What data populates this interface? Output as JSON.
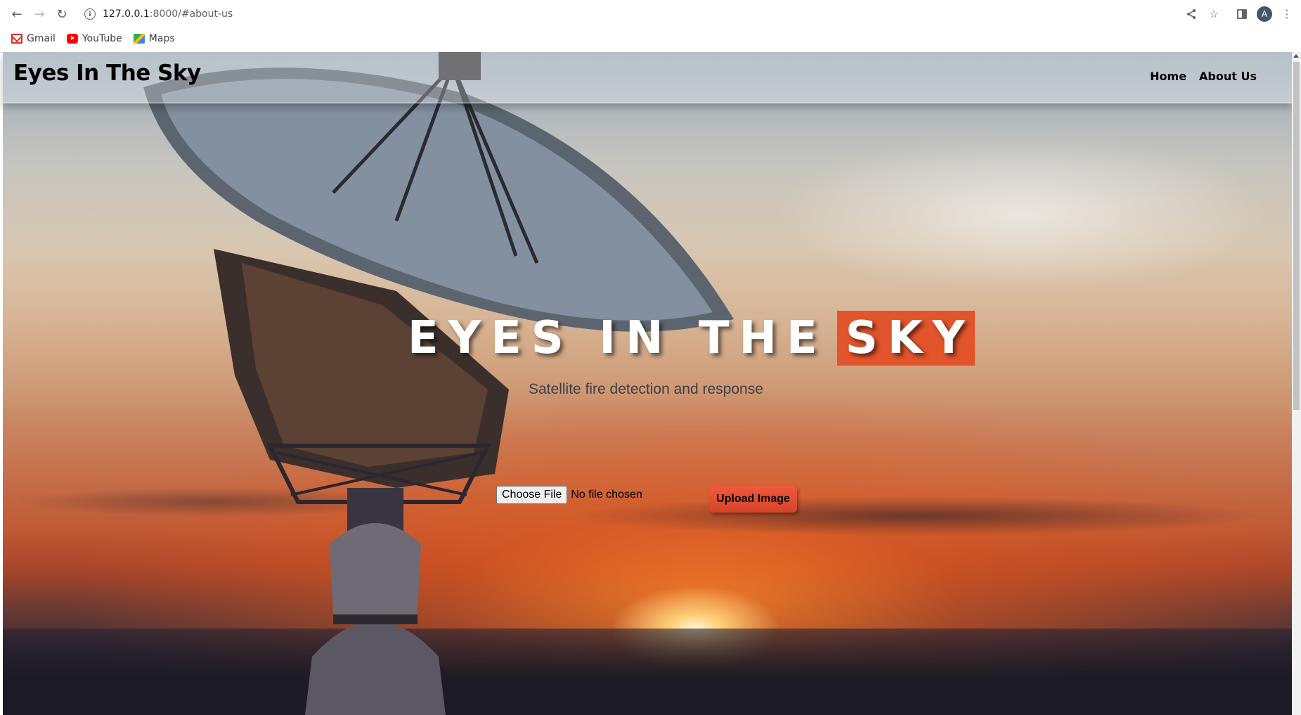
{
  "browser": {
    "url_host": "127.0.0.1",
    "url_rest": ":8000/#about-us",
    "back_icon": "arrow-left",
    "forward_icon": "arrow-right",
    "reload_icon": "reload",
    "avatar_letter": "A",
    "bookmarks": [
      {
        "label": "Gmail",
        "icon": "gmail-icon"
      },
      {
        "label": "YouTube",
        "icon": "youtube-icon"
      },
      {
        "label": "Maps",
        "icon": "maps-icon"
      }
    ]
  },
  "site": {
    "logo": "Eyes In The Sky",
    "nav": [
      {
        "label": "Home"
      },
      {
        "label": "About Us"
      }
    ]
  },
  "hero": {
    "title_main": "EYES IN THE",
    "title_highlight": "SKY",
    "tagline": "Satellite fire detection and response",
    "choose_file_label": "Choose File",
    "file_status": "No file chosen",
    "upload_label": "Upload Image",
    "accent_color": "#e2542b"
  }
}
